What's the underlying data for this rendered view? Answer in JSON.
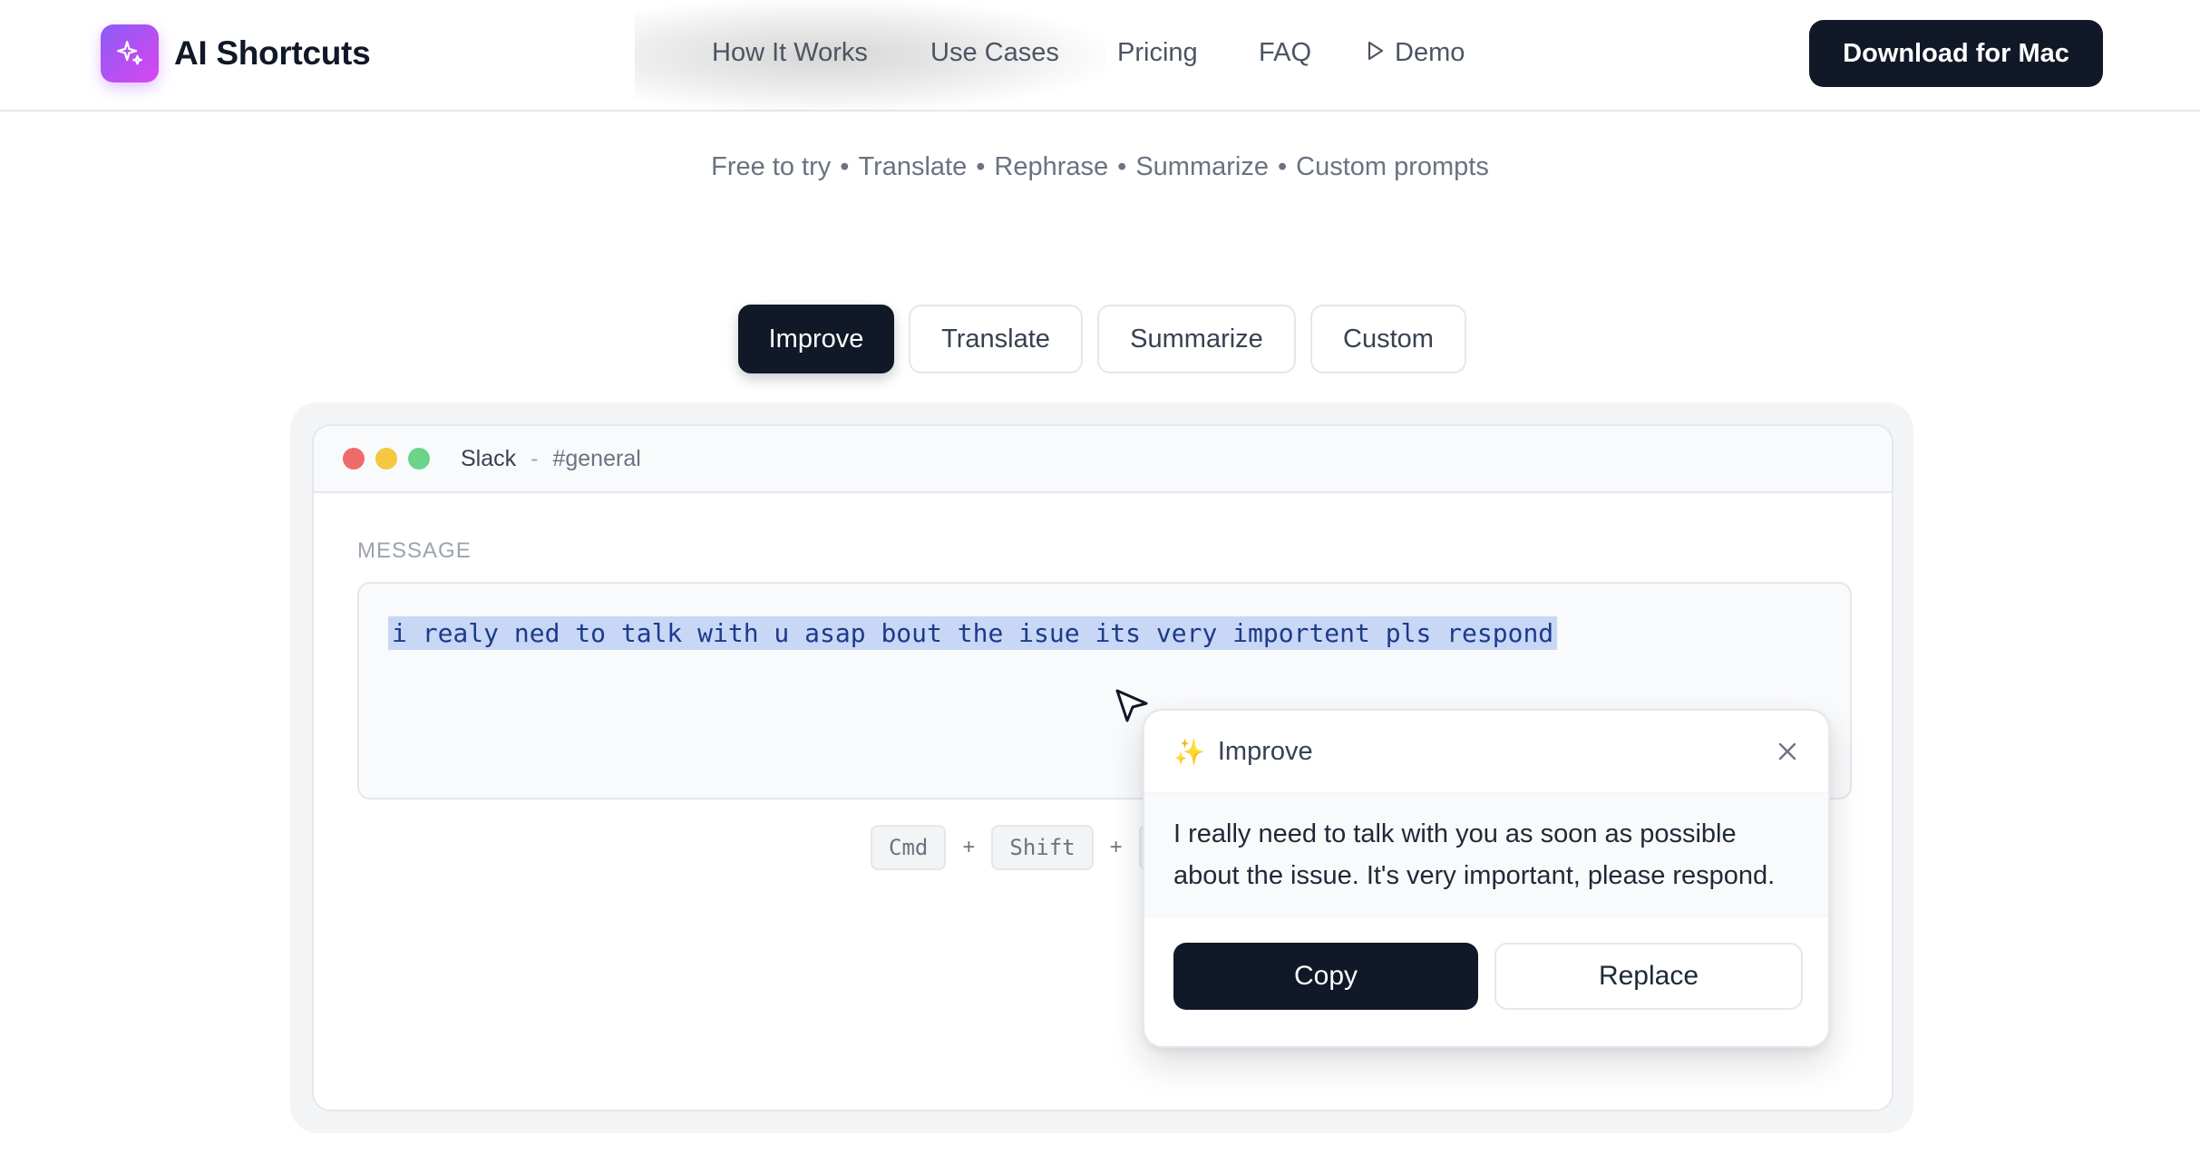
{
  "brand": {
    "name": "AI Shortcuts",
    "logo_icon": "sparkle-icon",
    "accent": "#a855f7"
  },
  "nav": {
    "items": [
      "How It Works",
      "Use Cases",
      "Pricing",
      "FAQ"
    ],
    "demo_label": "Demo",
    "demo_icon": "play-icon"
  },
  "cta": {
    "label": "Download for Mac"
  },
  "features": [
    "Free to try",
    "Translate",
    "Rephrase",
    "Summarize",
    "Custom prompts"
  ],
  "tabs": [
    {
      "label": "Improve",
      "active": true
    },
    {
      "label": "Translate",
      "active": false
    },
    {
      "label": "Summarize",
      "active": false
    },
    {
      "label": "Custom",
      "active": false
    }
  ],
  "window": {
    "app": "Slack",
    "separator": "-",
    "channel_hash": "#",
    "channel": "#general",
    "message_label": "MESSAGE",
    "message_text": "i realy ned to talk with u asap bout the isue its very importent pls respond",
    "shortcut_keys": [
      "Cmd",
      "Shift"
    ],
    "shortcut_plus": "+"
  },
  "popup": {
    "icon": "✨",
    "title": "Improve",
    "result": "I really need to talk with you as soon as possible about the issue. It's very important, please respond.",
    "copy_label": "Copy",
    "replace_label": "Replace"
  }
}
